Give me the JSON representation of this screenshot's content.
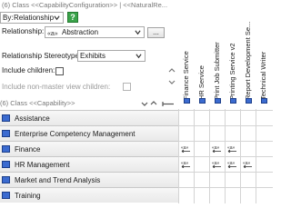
{
  "configuration_header": "(6) Class <<CapabilityConfiguration>> | <<NaturalRe...",
  "by": {
    "label": "By:",
    "value": "Relationship"
  },
  "relationship": {
    "label": "Relationship:",
    "value": "Abstraction",
    "browse_label": "..."
  },
  "stereotype": {
    "label": "Relationship Stereotype:",
    "value": "Exhibits"
  },
  "include_children": {
    "label": "Include children:"
  },
  "include_non_master": {
    "label": "Include non-master view children:"
  },
  "rows_header": "(6) Class <<Capability>>",
  "columns": [
    "Finance Service",
    "HR Service",
    "Print Job Submitter",
    "Printing Service v2",
    "Report Development Se...",
    "Technical Writer"
  ],
  "rows": [
    "Assistance",
    "Enterprise Competency Management",
    "Finance",
    "HR Management",
    "Market and Trend Analysis",
    "Training"
  ],
  "cells": [
    {
      "row": "Finance",
      "col": "Finance Service",
      "mark": "abstraction"
    },
    {
      "row": "Finance",
      "col": "Print Job Submitter",
      "mark": "abstraction"
    },
    {
      "row": "Finance",
      "col": "Printing Service v2",
      "mark": "abstraction"
    },
    {
      "row": "HR Management",
      "col": "Finance Service",
      "mark": "abstraction"
    },
    {
      "row": "HR Management",
      "col": "Print Job Submitter",
      "mark": "abstraction"
    },
    {
      "row": "HR Management",
      "col": "Printing Service v2",
      "mark": "abstraction"
    },
    {
      "row": "HR Management",
      "col": "Report Development Se...",
      "mark": "abstraction"
    }
  ],
  "colors": {
    "accent_icon": "#3b6bd0",
    "help_green": "#3aa34a"
  }
}
